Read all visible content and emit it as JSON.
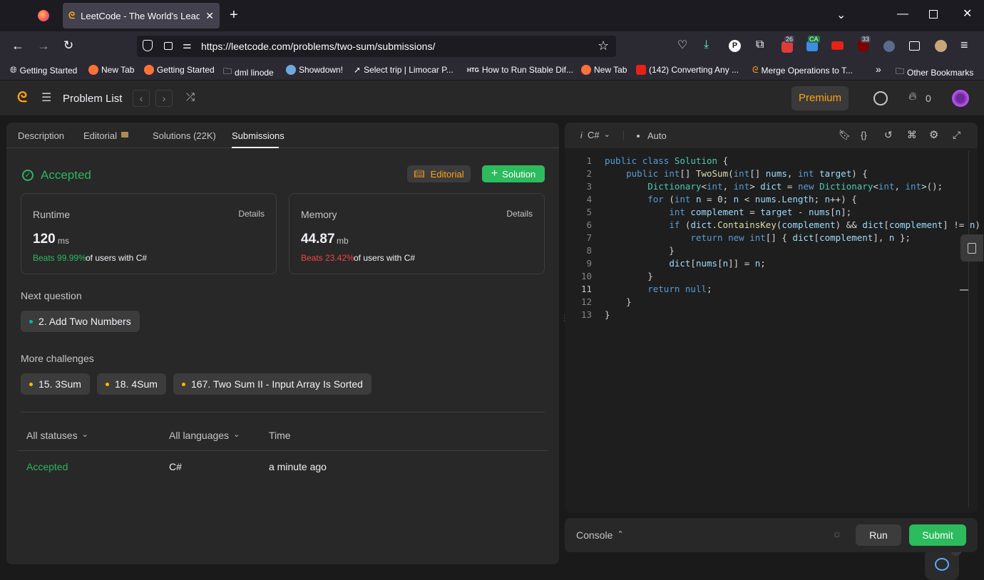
{
  "browser": {
    "tab_title": "LeetCode - The World's Leading",
    "url": "https://leetcode.com/problems/two-sum/submissions/",
    "bookmarks": [
      "Getting Started",
      "New Tab",
      "Getting Started",
      "dml linode",
      "Showdown!",
      "Select trip | Limocar P...",
      "How to Run Stable Dif...",
      "New Tab",
      "(142) Converting Any ...",
      "Merge Operations to T...",
      "Other Bookmarks"
    ],
    "ext_badges": [
      "26",
      "CA",
      "33"
    ]
  },
  "appbar": {
    "problem_list": "Problem List",
    "premium": "Premium",
    "streak": "0"
  },
  "left_tabs": [
    "Description",
    "Editorial",
    "Solutions (22K)",
    "Submissions"
  ],
  "result": {
    "status": "Accepted",
    "editorial_btn": "Editorial",
    "solution_btn": "Solution",
    "runtime": {
      "label": "Runtime",
      "details": "Details",
      "value": "120",
      "unit": "ms",
      "beats": "Beats 99.99%",
      "beats_suffix": "of users with C#"
    },
    "memory": {
      "label": "Memory",
      "details": "Details",
      "value": "44.87",
      "unit": "mb",
      "beats": "Beats 23.42%",
      "beats_suffix": "of users with C#"
    }
  },
  "next_question": {
    "heading": "Next question",
    "item": "2. Add Two Numbers"
  },
  "more_challenges": {
    "heading": "More challenges",
    "items": [
      "15. 3Sum",
      "18. 4Sum",
      "167. Two Sum II - Input Array Is Sorted"
    ]
  },
  "table": {
    "headers": [
      "All statuses",
      "All languages",
      "Time"
    ],
    "rows": [
      {
        "status": "Accepted",
        "language": "C#",
        "time": "a minute ago"
      }
    ]
  },
  "editor": {
    "language": "C#",
    "mode": "Auto",
    "line_numbers": [
      "1",
      "2",
      "3",
      "4",
      "5",
      "6",
      "7",
      "8",
      "9",
      "10",
      "11",
      "12",
      "13"
    ]
  },
  "console": {
    "label": "Console",
    "run": "Run",
    "submit": "Submit"
  },
  "colors": {
    "accent_green": "#2cbb5d",
    "accepted": "#2db55d",
    "red": "#ef4743",
    "amber": "#ffa116"
  }
}
